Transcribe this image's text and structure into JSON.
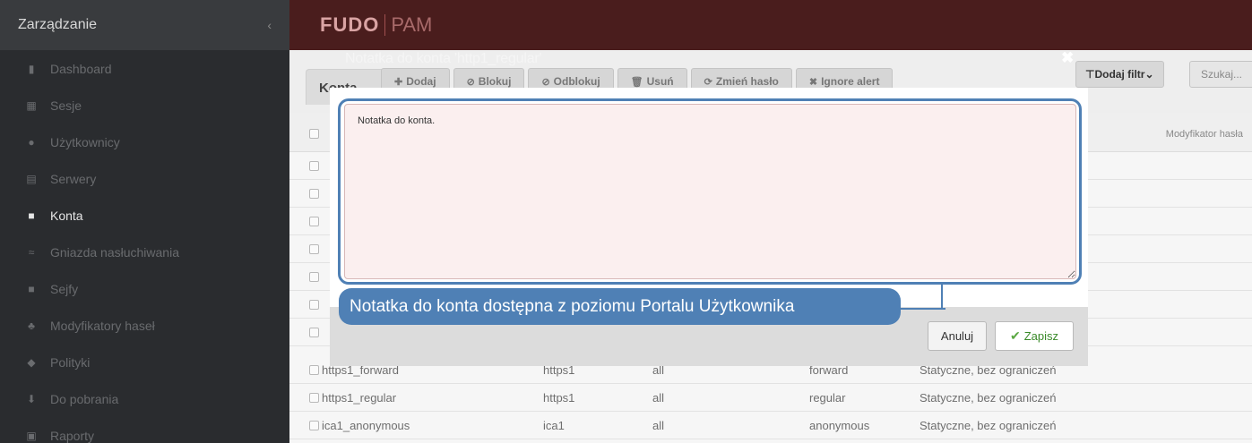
{
  "sidebar": {
    "title": "Zarządzanie",
    "collapse_glyph": "‹",
    "items": [
      {
        "label": "Dashboard",
        "icon": "bar-chart-icon",
        "glyph": "▮"
      },
      {
        "label": "Sesje",
        "icon": "film-icon",
        "glyph": "▦"
      },
      {
        "label": "Użytkownicy",
        "icon": "users-icon",
        "glyph": "●"
      },
      {
        "label": "Serwery",
        "icon": "server-icon",
        "glyph": "▤"
      },
      {
        "label": "Konta",
        "icon": "book-icon",
        "glyph": "■",
        "active": true
      },
      {
        "label": "Gniazda nasłuchiwania",
        "icon": "rss-icon",
        "glyph": "≈"
      },
      {
        "label": "Sejfy",
        "icon": "safe-icon",
        "glyph": "■"
      },
      {
        "label": "Modyfikatory haseł",
        "icon": "sitemap-icon",
        "glyph": "♣"
      },
      {
        "label": "Polityki",
        "icon": "shield-icon",
        "glyph": "◆"
      },
      {
        "label": "Do pobrania",
        "icon": "download-icon",
        "glyph": "⬇"
      },
      {
        "label": "Raporty",
        "icon": "report-icon",
        "glyph": "▣"
      }
    ]
  },
  "topbar": {
    "brand": "FUDO",
    "product": "PAM"
  },
  "page": {
    "tab_label": "Konta",
    "toolbar": [
      {
        "label": "Dodaj",
        "glyph": "✚"
      },
      {
        "label": "Blokuj",
        "glyph": "⊘"
      },
      {
        "label": "Odblokuj",
        "glyph": "⊘"
      },
      {
        "label": "Usuń",
        "glyph": "🗑"
      },
      {
        "label": "Zmień hasło",
        "glyph": "⟳"
      },
      {
        "label": "Ignore alert",
        "glyph": "✖"
      }
    ],
    "filter_label": "Dodaj filtr",
    "search_placeholder": "Szukaj...",
    "column_header": "Modyfikator hasła",
    "rows": [
      {
        "name": "https1_forward",
        "server": "https1",
        "scope": "all",
        "type": "forward",
        "modifier": "Statyczne, bez ograniczeń"
      },
      {
        "name": "https1_regular",
        "server": "https1",
        "scope": "all",
        "type": "regular",
        "modifier": "Statyczne, bez ograniczeń"
      },
      {
        "name": "ica1_anonymous",
        "server": "ica1",
        "scope": "all",
        "type": "anonymous",
        "modifier": "Statyczne, bez ograniczeń"
      }
    ]
  },
  "modal": {
    "title": "Notatka do konta 'http1_regular'",
    "close_glyph": "✖",
    "note_value": "Notatka do konta.",
    "callout": "Notatka do konta dostępna z poziomu Portalu Użytkownika",
    "cancel_label": "Anuluj",
    "save_label": "Zapisz",
    "save_glyph": "✔"
  },
  "colors": {
    "accent": "#4f80b5",
    "topbar": "#4a1d1d",
    "sidebar": "#2a2c2f"
  }
}
